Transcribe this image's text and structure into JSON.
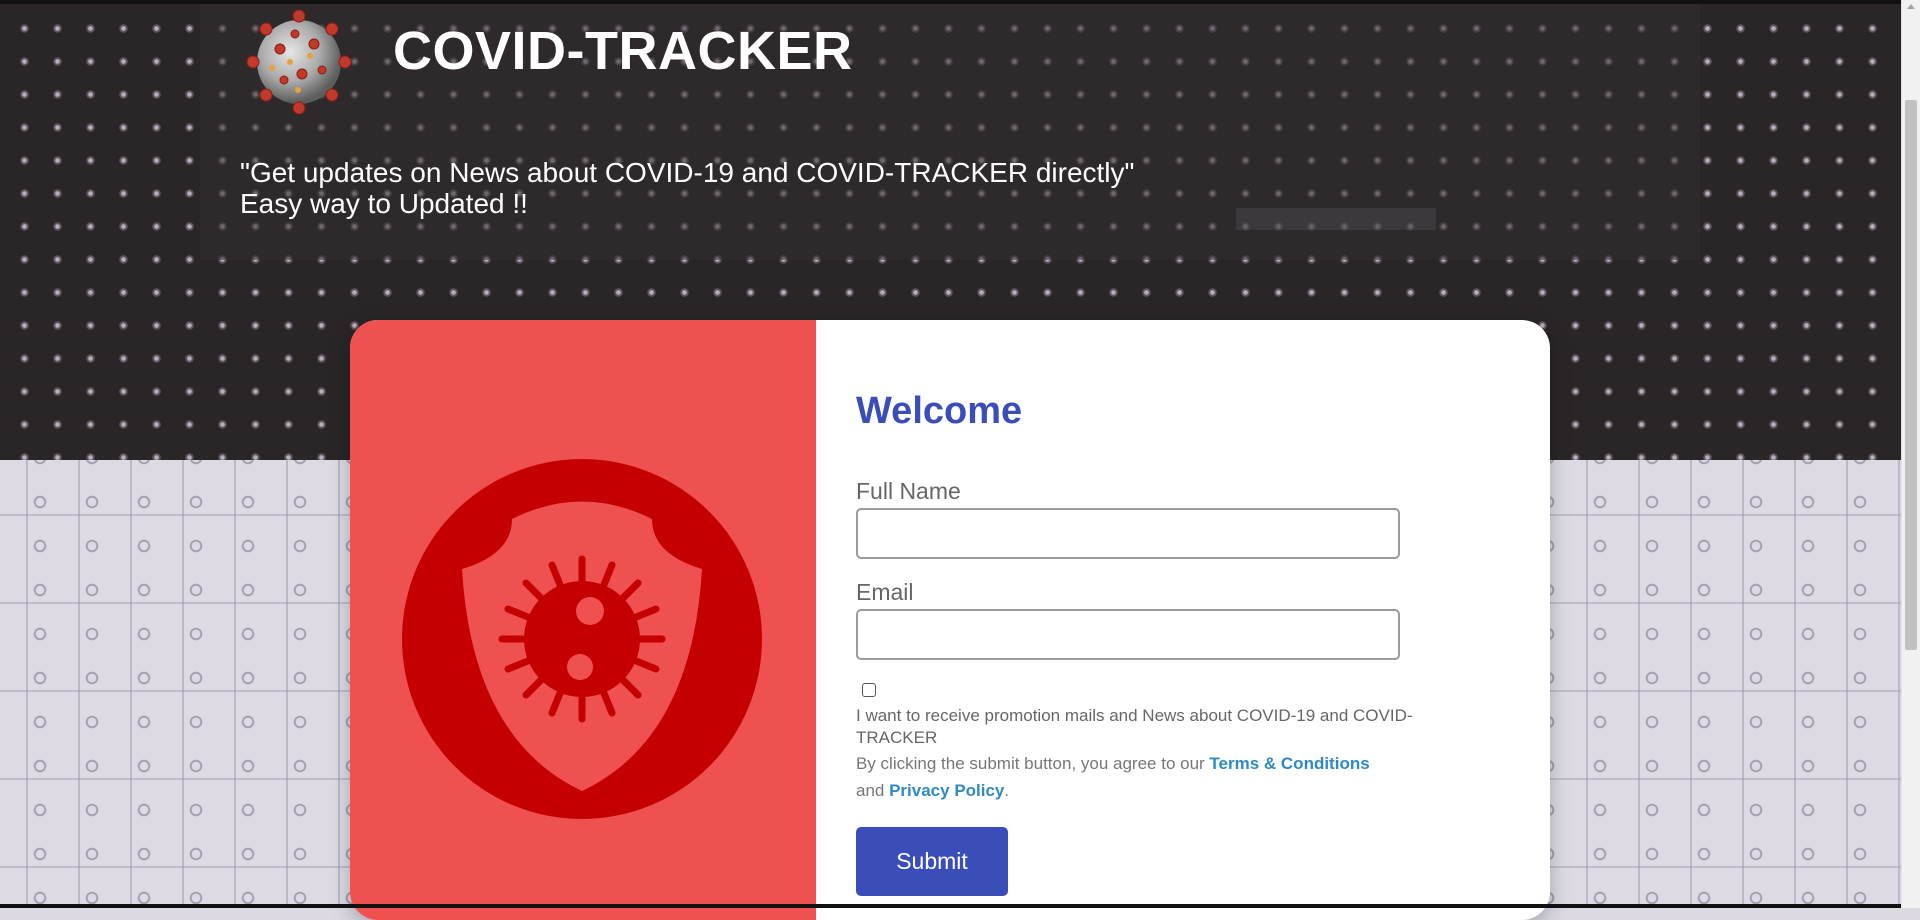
{
  "header": {
    "title": "COVID-TRACKER",
    "tagline_line1": "\"Get updates on News about COVID-19 and COVID-TRACKER directly\"",
    "tagline_line2": "Easy way to Updated !!",
    "logo_icon": "virus-logo-icon"
  },
  "form": {
    "heading": "Welcome",
    "full_name_label": "Full Name",
    "full_name_value": "",
    "email_label": "Email",
    "email_value": "",
    "promo_checked": false,
    "promo_text": "I want to receive promotion mails and News about COVID-19 and COVID-TRACKER",
    "terms_prefix": "By clicking the submit button, you agree to our ",
    "terms_link": "Terms & Conditions",
    "terms_middle": "and ",
    "privacy_link": "Privacy Policy",
    "terms_suffix": ".",
    "submit_label": "Submit"
  },
  "illustration": {
    "icon": "shield-virus-icon"
  },
  "colors": {
    "accent": "#3b4db8",
    "card_left": "#ef5050",
    "shield_dark": "#c40000",
    "link": "#2f8ac4"
  }
}
